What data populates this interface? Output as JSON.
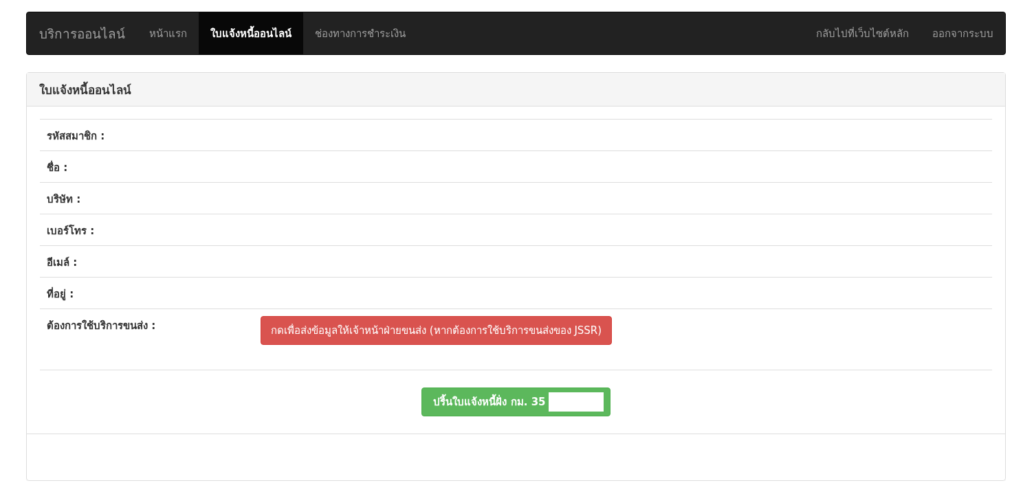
{
  "navbar": {
    "brand": "บริการออนไลน์",
    "left_items": [
      {
        "label": "หน้าแรก",
        "selected": false
      },
      {
        "label": "ใบแจ้งหนี้ออนไลน์",
        "selected": true
      },
      {
        "label": "ช่องทางการชำระเงิน",
        "selected": false
      }
    ],
    "right_items": [
      {
        "label": "กลับไปที่เว็บไซต์หลัก",
        "selected": false
      },
      {
        "label": "ออกจากระบบ",
        "selected": false
      }
    ]
  },
  "panel": {
    "title": "ใบแจ้งหนี้ออนไลน์",
    "fields": [
      {
        "label": "รหัสสมาชิก :"
      },
      {
        "label": "ชื่อ :"
      },
      {
        "label": "บริษัท :"
      },
      {
        "label": "เบอร์โทร :"
      },
      {
        "label": "อีเมล์ :"
      },
      {
        "label": "ที่อยู่ :"
      },
      {
        "label": "ต้องการใช้บริการขนส่ง :",
        "button": "กดเพื่อส่งข้อมูลให้เจ้าหน้าฝ่ายขนส่ง (หากต้องการใช้บริการขนส่งของ JSSR)"
      }
    ],
    "print_button": "ปริ้นใบแจ้งหนี้ฝั่ง กม. 35"
  }
}
